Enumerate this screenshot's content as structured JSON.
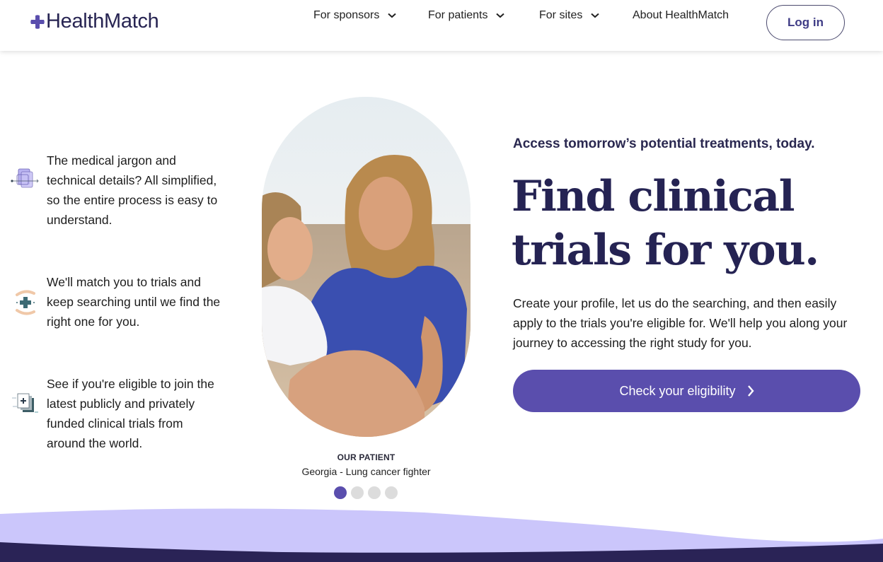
{
  "header": {
    "logo_text": "HealthMatch",
    "nav": [
      {
        "label": "For sponsors",
        "has_dropdown": true
      },
      {
        "label": "For patients",
        "has_dropdown": true
      },
      {
        "label": "For sites",
        "has_dropdown": true
      },
      {
        "label": "About HealthMatch",
        "has_dropdown": false
      }
    ],
    "login_label": "Log in"
  },
  "features": [
    {
      "icon": "layered-documents-icon",
      "text": "The medical jargon and technical details? All simplified, so the entire process is easy to understand."
    },
    {
      "icon": "hands-medical-cross-icon",
      "text": "We'll match you to trials and keep searching until we find the right one for you."
    },
    {
      "icon": "stacked-cards-plus-icon",
      "text": "See if you're eligible to join the latest publicly and privately funded clinical trials from around the world."
    }
  ],
  "testimonial": {
    "label": "OUR PATIENT",
    "name": "Georgia - Lung cancer fighter",
    "carousel": {
      "total": 4,
      "active_index": 0
    }
  },
  "hero": {
    "tagline": "Access tomorrow’s potential treatments, today.",
    "headline": "Find clinical trials for you.",
    "description": "Create your profile, let us do the searching, and then easily apply to the trials you're eligible for. We'll help you along your journey to accessing the right study for you.",
    "cta_label": "Check your eligibility"
  },
  "colors": {
    "brand_primary": "#5a4ead",
    "brand_dark": "#272452",
    "wave_light": "#cbc6fb",
    "wave_dark": "#2a2356",
    "dot_inactive": "#dcdcdc"
  }
}
